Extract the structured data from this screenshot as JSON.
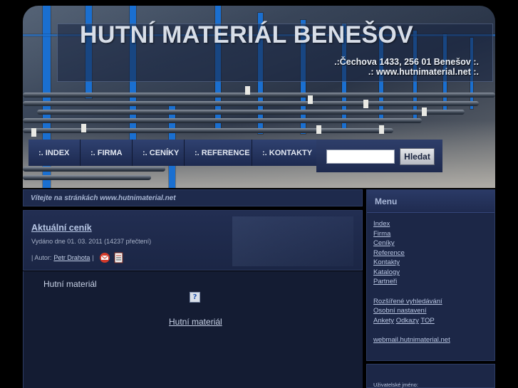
{
  "header": {
    "site_title": "HUTNÍ MATERIÁL BENEŠOV",
    "address": ".:Čechova 1433, 256 01 Benešov :.",
    "website": ".: www.hutnimaterial.net :."
  },
  "nav": {
    "items": [
      {
        "label": ":. INDEX"
      },
      {
        "label": ":. FIRMA"
      },
      {
        "label": ":. CENÍKY"
      },
      {
        "label": ":. REFERENCE"
      },
      {
        "label": ":. KONTAKTY"
      }
    ]
  },
  "search": {
    "input_value": "",
    "button_label": "Hledat"
  },
  "welcome": "Vítejte na stránkách www.hutnimaterial.net",
  "article": {
    "title": "Aktuální ceník",
    "meta": "Vydáno dne 01. 03. 2011 (14237 přečtení)",
    "author_prefix": "| Autor:",
    "author_name": "Petr Drahota",
    "author_suffix": "|",
    "body_heading": "Hutní materiál",
    "body_link": "Hutní materiál",
    "broken_image_glyph": "?"
  },
  "sidebar": {
    "menu_title": "Menu",
    "links": [
      {
        "label": "Index"
      },
      {
        "label": "Firma"
      },
      {
        "label": "Ceníky"
      },
      {
        "label": "Reference"
      },
      {
        "label": "Kontakty"
      },
      {
        "label": "Katalogy"
      },
      {
        "label": "Partneři"
      }
    ],
    "extra_links": [
      {
        "label": "Rozšířené vyhledávání"
      },
      {
        "label": "Osobní nastavení"
      }
    ],
    "inline_links": [
      {
        "label": "Ankety"
      },
      {
        "label": "Odkazy"
      },
      {
        "label": "TOP"
      }
    ],
    "webmail": "webmail.hutnimaterial.net",
    "login_label": "Uživatelské jméno:"
  },
  "colors": {
    "accent_blue": "#1a6fd0",
    "panel_bg": "#1c2747",
    "body_bg": "#000000"
  }
}
